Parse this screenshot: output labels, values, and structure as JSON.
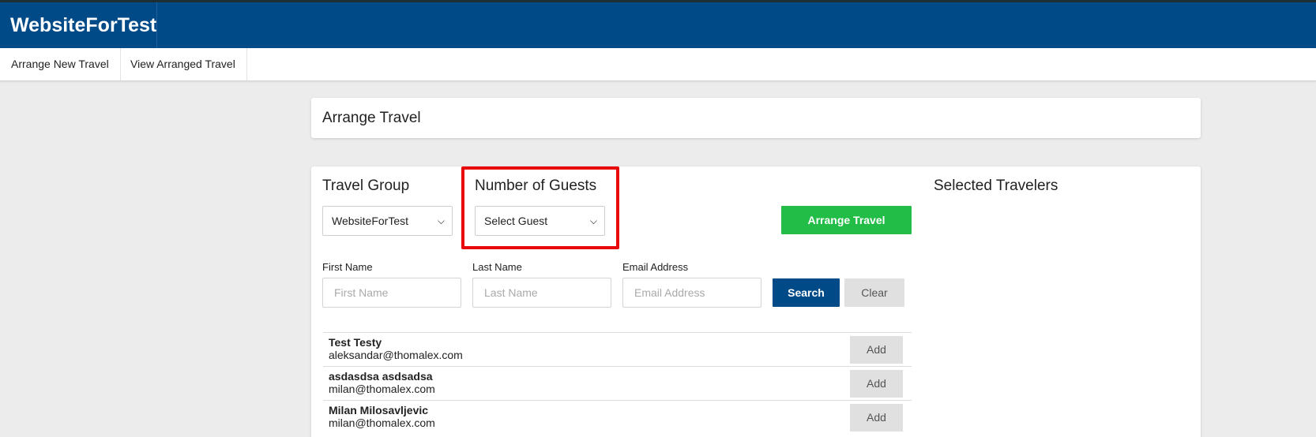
{
  "app": {
    "brand": "WebsiteForTest"
  },
  "nav": {
    "items": [
      {
        "label": "Arrange New Travel"
      },
      {
        "label": "View Arranged Travel"
      }
    ]
  },
  "page": {
    "title": "Arrange Travel"
  },
  "form": {
    "travel_group": {
      "heading": "Travel Group",
      "selected": "WebsiteForTest"
    },
    "guests": {
      "heading": "Number of Guests",
      "selected": "Select Guest"
    },
    "arrange_button": "Arrange Travel",
    "selected_heading": "Selected Travelers",
    "first_name": {
      "label": "First Name",
      "placeholder": "First Name",
      "value": ""
    },
    "last_name": {
      "label": "Last Name",
      "placeholder": "Last Name",
      "value": ""
    },
    "email": {
      "label": "Email Address",
      "placeholder": "Email Address",
      "value": ""
    },
    "search_button": "Search",
    "clear_button": "Clear"
  },
  "travelers": [
    {
      "name": "Test Testy",
      "email": "aleksandar@thomalex.com",
      "action": "Add"
    },
    {
      "name": "asdasdsa asdsadsa",
      "email": "milan@thomalex.com",
      "action": "Add"
    },
    {
      "name": "Milan Milosavljevic",
      "email": "milan@thomalex.com",
      "action": "Add"
    }
  ],
  "icons": {
    "dropdown": "chevron-down-icon"
  },
  "colors": {
    "brand": "#004a87",
    "success": "#21bd47",
    "highlight": "#e8090c"
  }
}
